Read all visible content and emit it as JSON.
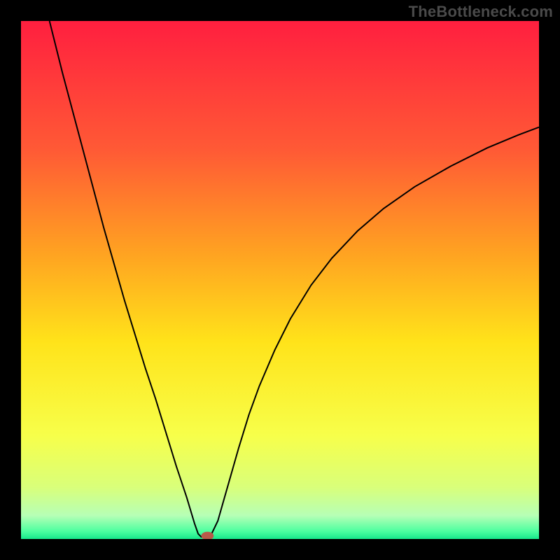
{
  "watermark": "TheBottleneck.com",
  "chart_data": {
    "type": "line",
    "background_gradient": {
      "stops": [
        {
          "offset": 0.0,
          "color": "#ff1f3f"
        },
        {
          "offset": 0.25,
          "color": "#ff5a35"
        },
        {
          "offset": 0.45,
          "color": "#ffa321"
        },
        {
          "offset": 0.62,
          "color": "#ffe31a"
        },
        {
          "offset": 0.8,
          "color": "#f7ff4a"
        },
        {
          "offset": 0.9,
          "color": "#d9ff7a"
        },
        {
          "offset": 0.955,
          "color": "#b6ffb6"
        },
        {
          "offset": 0.985,
          "color": "#4dffa0"
        },
        {
          "offset": 1.0,
          "color": "#17e88b"
        }
      ]
    },
    "x_range": [
      0,
      100
    ],
    "y_range": [
      0,
      100
    ],
    "title": "",
    "xlabel": "",
    "ylabel": "",
    "series": [
      {
        "name": "bottleneck-curve",
        "color": "#000000",
        "stroke_width": 2,
        "points": [
          {
            "x": 5.5,
            "y": 100.0
          },
          {
            "x": 8.0,
            "y": 90.0
          },
          {
            "x": 12.0,
            "y": 75.0
          },
          {
            "x": 16.0,
            "y": 60.0
          },
          {
            "x": 20.0,
            "y": 46.0
          },
          {
            "x": 24.0,
            "y": 33.0
          },
          {
            "x": 26.0,
            "y": 27.0
          },
          {
            "x": 28.0,
            "y": 20.5
          },
          {
            "x": 30.0,
            "y": 14.0
          },
          {
            "x": 32.0,
            "y": 8.0
          },
          {
            "x": 33.5,
            "y": 3.0
          },
          {
            "x": 34.2,
            "y": 1.0
          },
          {
            "x": 34.8,
            "y": 0.4
          },
          {
            "x": 36.0,
            "y": 0.4
          },
          {
            "x": 36.8,
            "y": 1.0
          },
          {
            "x": 38.0,
            "y": 3.5
          },
          {
            "x": 39.0,
            "y": 7.0
          },
          {
            "x": 40.0,
            "y": 10.5
          },
          {
            "x": 42.0,
            "y": 17.5
          },
          {
            "x": 44.0,
            "y": 24.0
          },
          {
            "x": 46.0,
            "y": 29.5
          },
          {
            "x": 49.0,
            "y": 36.5
          },
          {
            "x": 52.0,
            "y": 42.5
          },
          {
            "x": 56.0,
            "y": 49.0
          },
          {
            "x": 60.0,
            "y": 54.2
          },
          {
            "x": 65.0,
            "y": 59.5
          },
          {
            "x": 70.0,
            "y": 63.8
          },
          {
            "x": 76.0,
            "y": 68.0
          },
          {
            "x": 83.0,
            "y": 72.0
          },
          {
            "x": 90.0,
            "y": 75.5
          },
          {
            "x": 96.0,
            "y": 78.0
          },
          {
            "x": 100.0,
            "y": 79.5
          }
        ]
      }
    ],
    "marker": {
      "name": "min-marker",
      "x": 36.0,
      "y": 0.6,
      "rx": 1.2,
      "ry": 0.8,
      "color": "#b85a4a"
    }
  }
}
